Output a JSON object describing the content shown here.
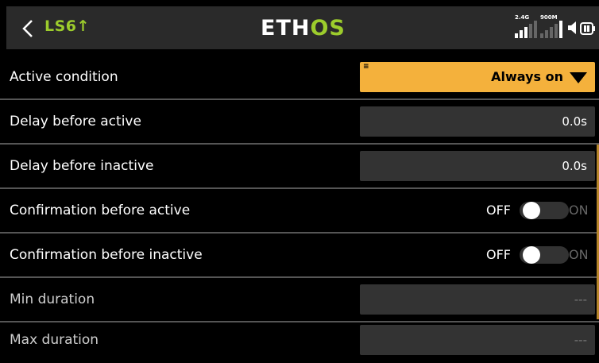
{
  "header": {
    "title": "LS6↑",
    "logo_main": "ETH",
    "logo_accent": "OS",
    "signal_24_label": "2.4G",
    "signal_900_label": "900M"
  },
  "rows": [
    {
      "label": "Active condition",
      "value": "Always on"
    },
    {
      "label": "Delay before active",
      "value": "0.0s"
    },
    {
      "label": "Delay before inactive",
      "value": "0.0s"
    },
    {
      "label": "Confirmation before active",
      "off": "OFF",
      "on": "ON"
    },
    {
      "label": "Confirmation before inactive",
      "off": "OFF",
      "on": "ON"
    },
    {
      "label": "Min duration",
      "value": "---"
    },
    {
      "label": "Max duration",
      "value": "---"
    }
  ],
  "colors": {
    "accent_green": "#9ccc2c",
    "dropdown_orange": "#f4b13c",
    "field_bg": "#333333"
  },
  "icons": [
    "back-chevron-icon",
    "signal-bars-icon",
    "speaker-icon",
    "battery-icon",
    "caret-down-icon",
    "menu-lines-icon"
  ]
}
